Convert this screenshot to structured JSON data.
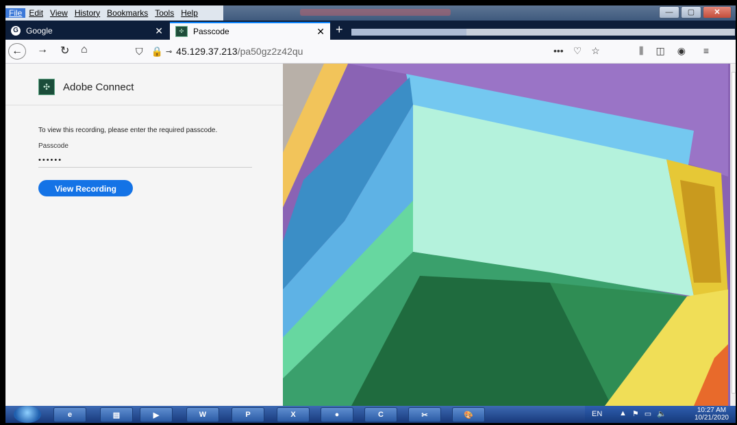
{
  "menu": {
    "items": [
      {
        "label": "File",
        "active": true
      },
      {
        "label": "Edit"
      },
      {
        "label": "View"
      },
      {
        "label": "History"
      },
      {
        "label": "Bookmarks"
      },
      {
        "label": "Tools"
      },
      {
        "label": "Help"
      }
    ]
  },
  "tabs": [
    {
      "label": "Google",
      "icon": "google-icon"
    },
    {
      "label": "Passcode",
      "icon": "adobe-connect-icon",
      "active": true
    }
  ],
  "nav": {
    "url_host": "45.129.37.213",
    "url_path": "/pa50gz2z42qu"
  },
  "page": {
    "brand": "Adobe Connect",
    "prompt": "To view this recording, please enter the required passcode.",
    "passcode_label": "Passcode",
    "passcode_value": "••••••",
    "button_label": "View Recording",
    "accent": "#1473e6"
  },
  "taskbar": {
    "items": [
      {
        "name": "ie-icon",
        "label": "e"
      },
      {
        "name": "explorer-icon",
        "label": "▤"
      },
      {
        "name": "media-icon",
        "label": "▶"
      },
      {
        "name": "word-icon",
        "label": "W"
      },
      {
        "name": "powerpoint-icon",
        "label": "P"
      },
      {
        "name": "excel-icon",
        "label": "X"
      },
      {
        "name": "firefox-icon",
        "label": "●"
      },
      {
        "name": "camtasia-icon",
        "label": "C"
      },
      {
        "name": "snipping-icon",
        "label": "✂"
      },
      {
        "name": "paint-icon",
        "label": "🎨"
      }
    ],
    "lang": "EN",
    "time": "10:27 AM",
    "date": "10/21/2020"
  }
}
